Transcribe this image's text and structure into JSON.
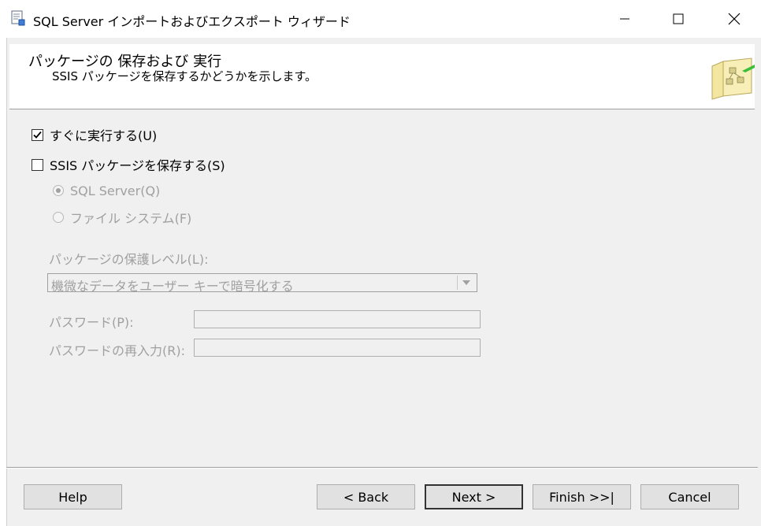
{
  "window": {
    "title": "SQL Server インポートおよびエクスポート ウィザード"
  },
  "header": {
    "title": "パッケージの 保存および 実行",
    "subtitle": "SSIS パッケージを保存するかどうかを示します。"
  },
  "options": {
    "run_immediately": {
      "label": "すぐに実行する(U)",
      "checked": true
    },
    "save_package": {
      "label": "SSIS パッケージを保存する(S)",
      "checked": false
    },
    "sql_server": {
      "label": "SQL Server(Q)",
      "selected": true,
      "enabled": false
    },
    "file_system": {
      "label": "ファイル システム(F)",
      "selected": false,
      "enabled": false
    }
  },
  "protection": {
    "label": "パッケージの保護レベル(L):",
    "selected": "機微なデータをユーザー キーで暗号化する"
  },
  "password": {
    "label": "パスワード(P):",
    "value": ""
  },
  "password_confirm": {
    "label": "パスワードの再入力(R):",
    "value": ""
  },
  "buttons": {
    "help": "Help",
    "back": "< Back",
    "next": "Next >",
    "finish": "Finish >>|",
    "cancel": "Cancel"
  },
  "colors": {
    "disabled_text": "#a0a0a0",
    "button_face": "#e1e1e1",
    "window_bg": "#f0f0f0"
  }
}
